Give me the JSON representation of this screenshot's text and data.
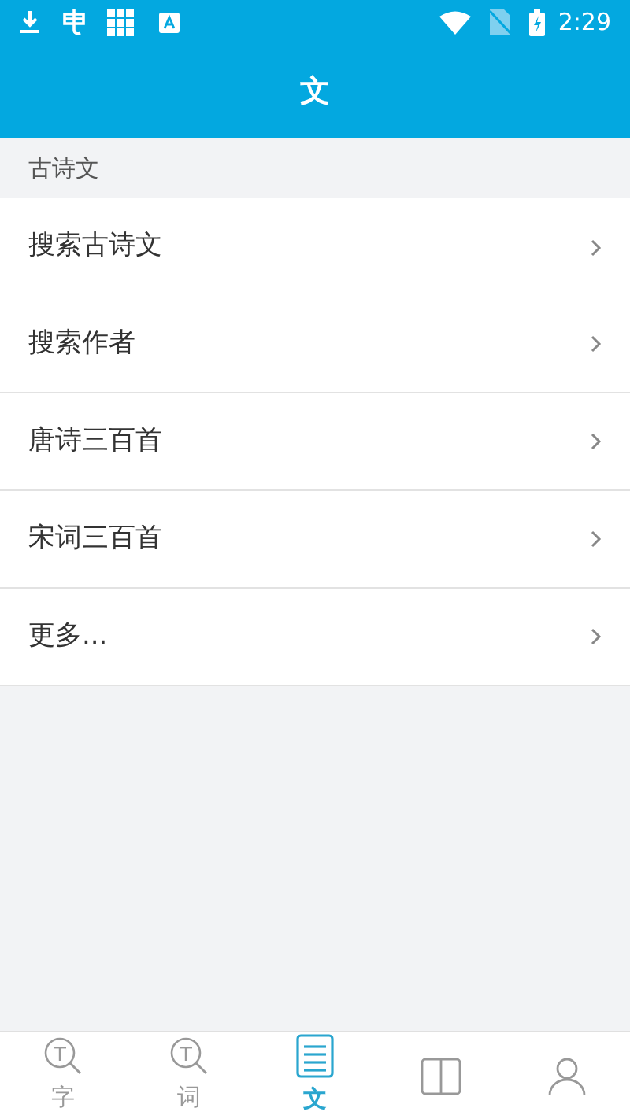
{
  "status_bar": {
    "time": "2:29"
  },
  "header": {
    "title": "文"
  },
  "section": {
    "title": "古诗文"
  },
  "items": [
    {
      "label": "搜索古诗文",
      "divider": false
    },
    {
      "label": "搜索作者",
      "divider": true
    },
    {
      "label": "唐诗三百首",
      "divider": true
    },
    {
      "label": "宋词三百首",
      "divider": true
    },
    {
      "label": "更多...",
      "divider": true
    }
  ],
  "tabs": [
    {
      "kind": "zi",
      "label": "字",
      "selected": false
    },
    {
      "kind": "ci",
      "label": "词",
      "selected": false
    },
    {
      "kind": "doc",
      "label": "文",
      "selected": true
    },
    {
      "kind": "book",
      "selected": false
    },
    {
      "kind": "person",
      "selected": false
    }
  ]
}
